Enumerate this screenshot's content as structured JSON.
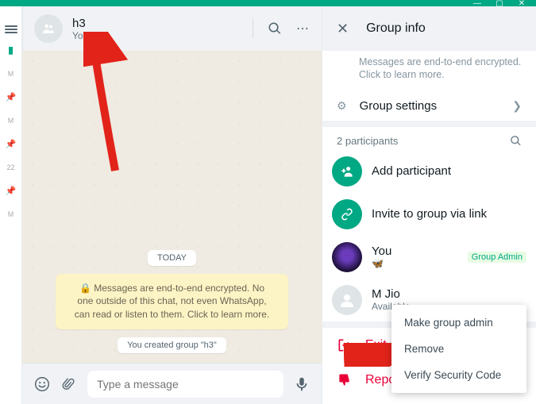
{
  "window": {
    "min": "—",
    "max": "▢",
    "close": "✕"
  },
  "sidebar_glimpse": {
    "items": [
      "M",
      "M",
      "22",
      "M"
    ]
  },
  "chat": {
    "title": "h3",
    "subtitle": "You, M",
    "today": "TODAY",
    "encryption": "🔒 Messages are end-to-end encrypted. No one outside of this chat, not even WhatsApp, can read or listen to them. Click to learn more.",
    "created": "You created group \"h3\"",
    "input_placeholder": "Type a message"
  },
  "info": {
    "title": "Group info",
    "enc_hint": "Messages are end-to-end encrypted. Click to learn more.",
    "settings": "Group settings",
    "participants_count": "2 participants",
    "add": "Add participant",
    "invite": "Invite to group via link",
    "you": {
      "name": "You",
      "sub": "🦋",
      "badge": "Group Admin"
    },
    "member": {
      "name": "M Jio",
      "sub": "Available"
    },
    "exit": "Exit gro",
    "report": "Report"
  },
  "menu": {
    "make_admin": "Make group admin",
    "remove": "Remove",
    "verify": "Verify Security Code"
  }
}
